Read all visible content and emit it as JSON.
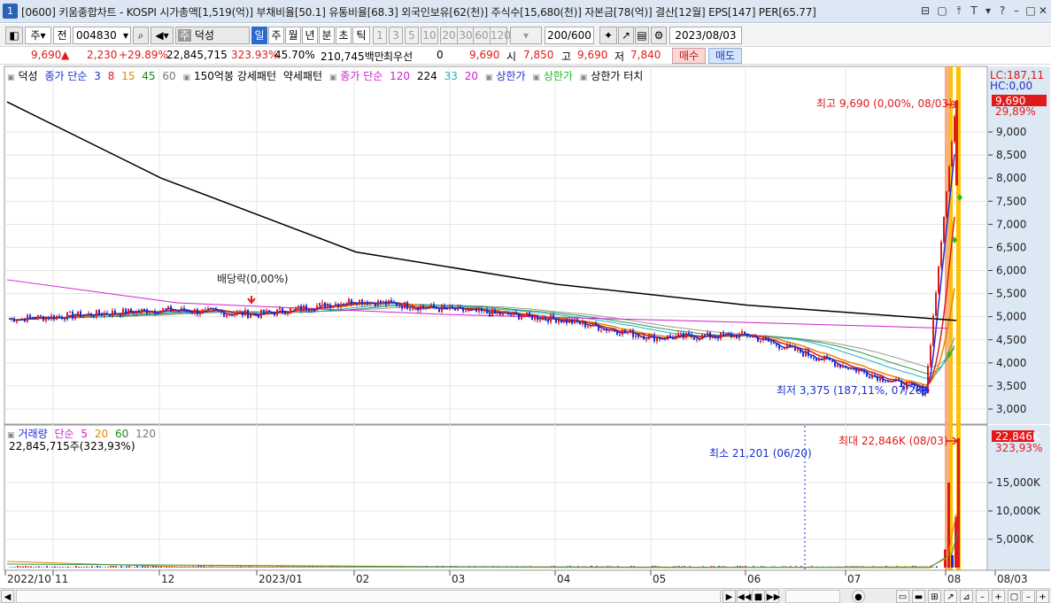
{
  "window": {
    "number": "1",
    "title": "[0600] 키움종합차트 - KOSPI 시가총액[1,519(억)] 부채비율[50.1] 유통비율[68.3] 외국인보유[62(천)] 주식수[15,680(천)] 자본금[78(억)] 결산[12월] EPS[147] PER[65.77]",
    "controls": [
      "⊟",
      "▢",
      "⤒",
      "T",
      "▾",
      "?",
      "–",
      "□",
      "✕"
    ]
  },
  "toolbar": {
    "market": "주",
    "all": "전",
    "code": "004830",
    "name": "덕성",
    "name_prefix": "주",
    "periods": [
      "일",
      "주",
      "월",
      "년",
      "분",
      "초",
      "틱"
    ],
    "selected_period": "일",
    "intervals": [
      "1",
      "3",
      "5",
      "10",
      "20",
      "30",
      "60",
      "120"
    ],
    "count": "200",
    "count_total": "/600",
    "date": "2023/08/03"
  },
  "price": {
    "last": "9,690",
    "change": "2,230",
    "change_pct": "+29.89%",
    "volume": "22,845,715",
    "volume_pct": "323.93%",
    "turnover": "45.70%",
    "amount": "210,745백만",
    "prev_label": "최우선",
    "prev_value": "0",
    "bid": "9,690",
    "open_label": "시",
    "open": "7,850",
    "high_label": "고",
    "high": "9,690",
    "low_label": "저",
    "low": "7,840",
    "buy": "매수",
    "sell": "매도"
  },
  "legend_price": {
    "stock": "덕성",
    "ma_label": "종가 단순",
    "ma": [
      "3",
      "8",
      "15",
      "45",
      "60"
    ],
    "pattern1": "150억봉 강세패턴",
    "pattern2": "약세패턴",
    "ma2_label": "종가 단순",
    "ma2": [
      "120",
      "224",
      "33",
      "20"
    ],
    "limit1": "상한가",
    "limit2": "상한가",
    "limit3": "상한가 터치"
  },
  "legend_volume": {
    "label": "거래량",
    "ma_label": "단순",
    "ma": [
      "5",
      "20",
      "60",
      "120"
    ],
    "value": "22,845,715주(323,93%)"
  },
  "annotations": {
    "dividend": "배당락(0,00%)",
    "high": "최고 9,690 (0,00%, 08/03)",
    "low": "최저 3,375 (187,11%, 07/26)",
    "vol_max": "최대 22,846K (08/03)",
    "vol_min": "최소 21,201 (06/20)"
  },
  "right_axis": {
    "lc": "LC:187,11",
    "hc": "HC:0,00",
    "price_tag": "9,690",
    "price_tag_pct": "29,89%",
    "vol_tag": "22,846K",
    "vol_tag_pct": "323,93%"
  },
  "chart_data": {
    "type": "line",
    "price_axis": [
      "9,000",
      "8,500",
      "8,000",
      "7,500",
      "7,000",
      "6,500",
      "6,000",
      "5,500",
      "5,000",
      "4,500",
      "4,000",
      "3,500",
      "3,000"
    ],
    "volume_axis": [
      "15,000K",
      "10,000K",
      "5,000K"
    ],
    "x_labels": [
      "2022/10",
      "11",
      "12",
      "2023/01",
      "02",
      "03",
      "04",
      "05",
      "06",
      "07",
      "08",
      "08/03"
    ],
    "series": [
      {
        "name": "종가",
        "color": "#1a2fd0"
      },
      {
        "name": "224",
        "color": "#000000",
        "x": [
          "2022/10",
          "2022/12",
          "2023/02",
          "2023/04",
          "2023/06",
          "2023/08"
        ],
        "values": [
          9650,
          8000,
          6400,
          5700,
          5250,
          4920
        ]
      },
      {
        "name": "120",
        "color": "#d020d0"
      }
    ],
    "close_approx": {
      "x": [
        "2022/10",
        "2022/11",
        "2022/12",
        "2023/01",
        "2023/02",
        "2023/03",
        "2023/04",
        "2023/05",
        "2023/06",
        "2023/07/26",
        "2023/08/03"
      ],
      "values": [
        4950,
        5000,
        5150,
        5050,
        5350,
        5150,
        4950,
        4550,
        4600,
        3375,
        9690
      ]
    },
    "colors": {
      "up": "#e01a1a",
      "down": "#1a2fd0",
      "limit_band": "#ffb000",
      "limit_candle": "#e01a1a"
    }
  }
}
